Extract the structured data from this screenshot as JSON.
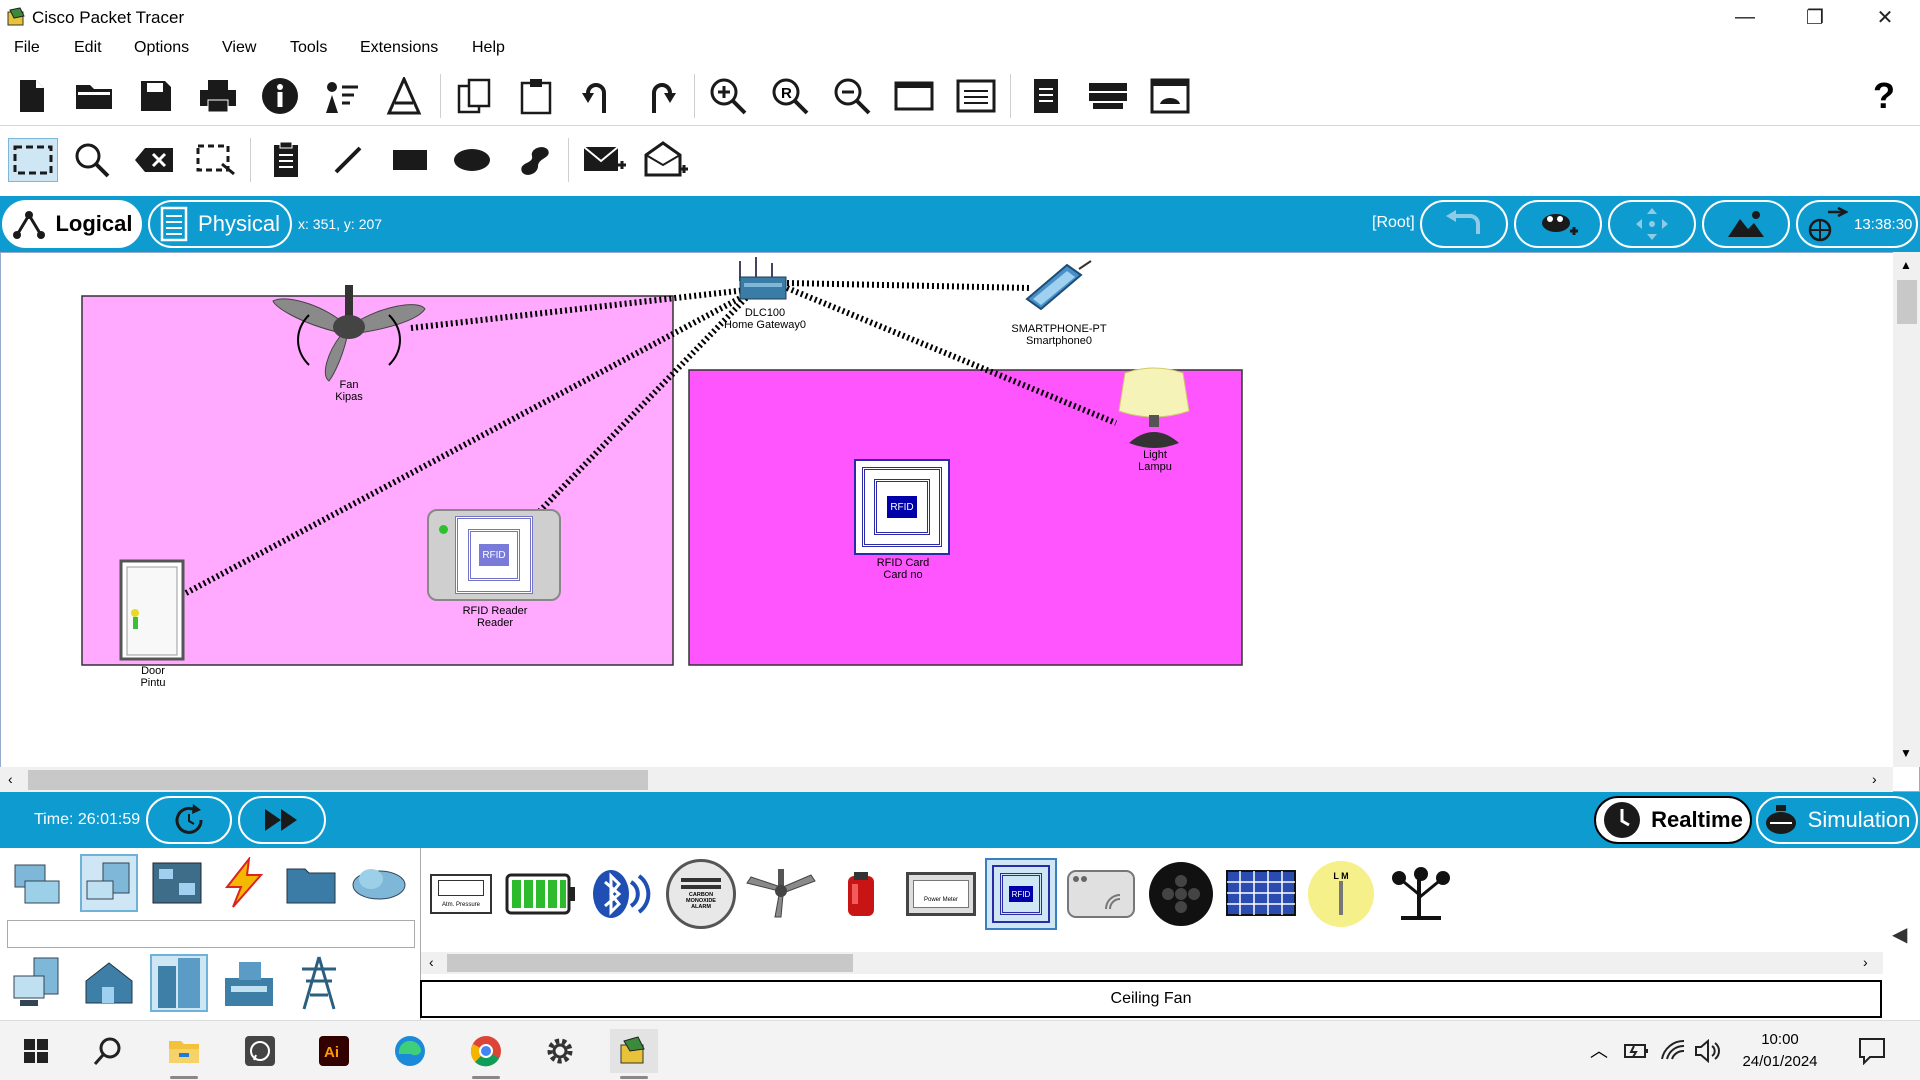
{
  "window": {
    "title": "Cisco Packet Tracer",
    "minimize": "—",
    "restore": "❐",
    "close": "✕"
  },
  "menu": [
    "File",
    "Edit",
    "Options",
    "View",
    "Tools",
    "Extensions",
    "Help"
  ],
  "toolbar1": [
    "new-icon",
    "open-icon",
    "save-icon",
    "print-icon",
    "info-icon",
    "activity-wizard-icon",
    "custom-device-icon",
    "copy-icon",
    "paste-icon",
    "undo-icon",
    "redo-icon",
    "zoom-in-icon",
    "zoom-reset-icon",
    "zoom-out-icon",
    "drawing-palette-icon",
    "custom-devices-dialog-icon",
    "pdu-list-icon",
    "network-info-icon",
    "viewport-icon",
    "help-icon"
  ],
  "help_label": "?",
  "toolbar2": [
    "select-icon",
    "inspect-icon",
    "delete-icon",
    "resize-shape-icon",
    "place-note-icon",
    "draw-line-icon",
    "draw-rectangle-icon",
    "draw-ellipse-icon",
    "freeform-icon",
    "add-simple-pdu-icon",
    "add-complex-pdu-icon"
  ],
  "modebar": {
    "logical": "Logical",
    "physical": "Physical",
    "coords": "x: 351, y: 207",
    "root": "[Root]",
    "clock": "13:38:30"
  },
  "devices": [
    {
      "id": "gateway",
      "line1": "DLC100",
      "line2": "Home Gateway0"
    },
    {
      "id": "smartphone",
      "line1": "SMARTPHONE-PT",
      "line2": "Smartphone0"
    },
    {
      "id": "fan",
      "line1": "Fan",
      "line2": "Kipas"
    },
    {
      "id": "light",
      "line1": "Light",
      "line2": "Lampu"
    },
    {
      "id": "rfid-card",
      "line1": "RFID Card",
      "line2": "Card no"
    },
    {
      "id": "rfid-reader",
      "line1": "RFID Reader",
      "line2": "Reader"
    },
    {
      "id": "door",
      "line1": "Door",
      "line2": "Pintu"
    }
  ],
  "rfid_badge": "RFID",
  "timebar": {
    "time": "Time: 26:01:59",
    "realtime": "Realtime",
    "simulation": "Simulation"
  },
  "device_list_labels": {
    "pressure": "Atm. Pressure",
    "co_alarm": "CARBON MONOXIDE ALARM",
    "power_meter": "Power Meter",
    "lm": "L M"
  },
  "selected_device_name": "Ceiling Fan",
  "taskbar": {
    "time": "10:00",
    "date": "24/01/2024"
  },
  "colors": {
    "accent_blue": "#0e9bd0",
    "room1": "#ffaaff",
    "room2": "#ff55ff"
  }
}
